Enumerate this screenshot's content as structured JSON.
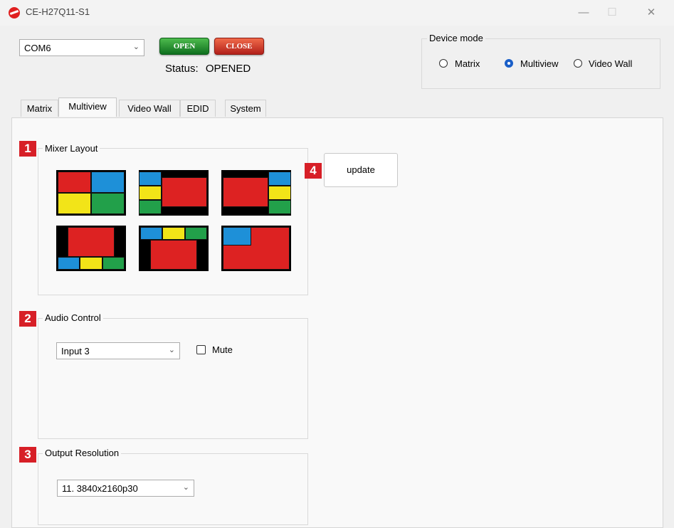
{
  "window": {
    "title": "CE-H27Q11-S1",
    "controls": {
      "minimize": "—",
      "maximize": "☐",
      "close": "✕"
    }
  },
  "connection": {
    "port": "COM6",
    "open_label": "OPEN",
    "close_label": "CLOSE",
    "status_label": "Status:",
    "status_value": "OPENED"
  },
  "device_mode": {
    "legend": "Device mode",
    "options": [
      "Matrix",
      "Multiview",
      "Video Wall"
    ],
    "selected": "Multiview"
  },
  "tabs": [
    "Matrix",
    "Multiview",
    "Video Wall",
    "EDID",
    "System"
  ],
  "active_tab": "Multiview",
  "sections": {
    "mixer_layout": {
      "badge": "1",
      "legend": "Mixer Layout"
    },
    "audio_control": {
      "badge": "2",
      "legend": "Audio Control",
      "input": "Input 3",
      "mute_label": "Mute",
      "mute_checked": false
    },
    "output_resolution": {
      "badge": "3",
      "legend": "Output Resolution",
      "value": "11. 3840x2160p30"
    },
    "update": {
      "badge": "4",
      "label": "update"
    }
  },
  "colors": {
    "red": "#dd2222",
    "blue": "#1e90d8",
    "yellow": "#f2e418",
    "green": "#22a04a",
    "badge": "#d71f27"
  }
}
